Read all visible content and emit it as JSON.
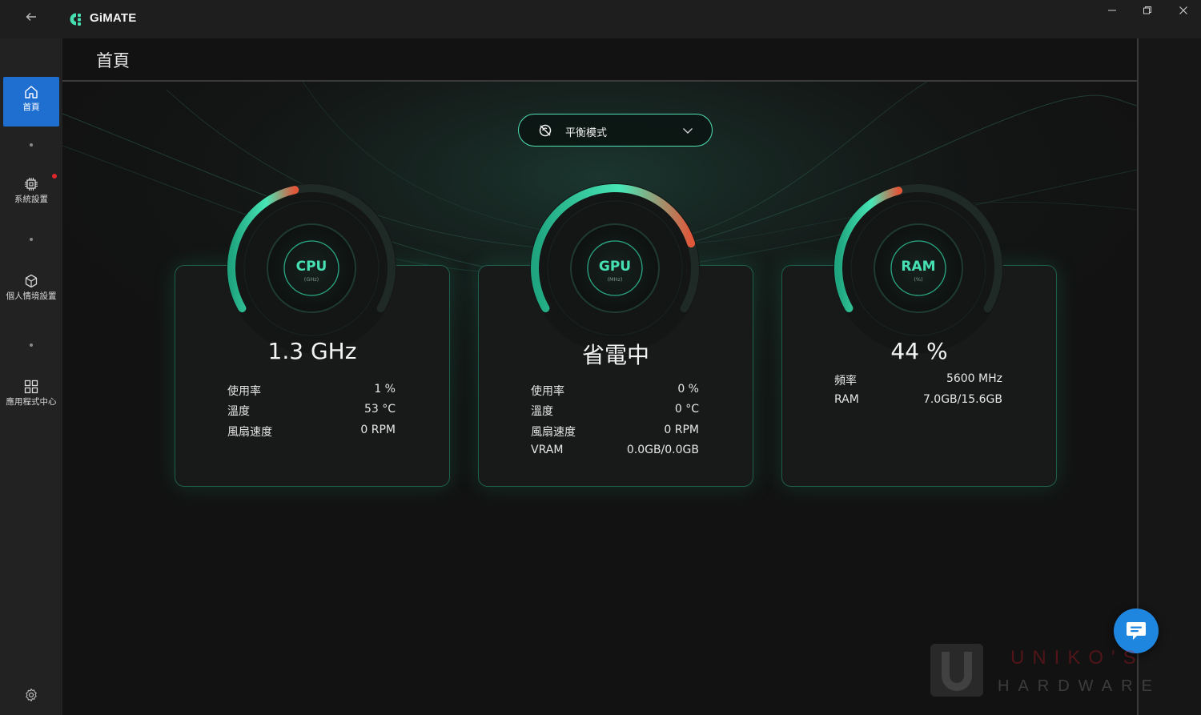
{
  "app": {
    "title": "GiMATE",
    "back_icon": "arrow-left-icon",
    "window_controls": [
      "minimize",
      "restore",
      "close"
    ]
  },
  "sidebar": {
    "items": [
      {
        "label": "首頁",
        "icon": "home-icon",
        "active": true
      },
      {
        "label": "系統設置",
        "icon": "chip-icon",
        "active": false,
        "notification": true
      },
      {
        "label": "個人情境設置",
        "icon": "cube-icon",
        "active": false
      },
      {
        "label": "應用程式中心",
        "icon": "apps-grid-icon",
        "active": false
      }
    ],
    "settings_icon": "gear-icon"
  },
  "page": {
    "title": "首頁"
  },
  "mode_select": {
    "value": "平衡模式",
    "icon": "balance-mode-icon"
  },
  "cards": {
    "cpu": {
      "name": "CPU",
      "unit": "(GHz)",
      "value": "1.3 GHz",
      "level": 0.45,
      "stats": [
        {
          "label": "使用率",
          "value": "1 %"
        },
        {
          "label": "溫度",
          "value": "53 °C"
        },
        {
          "label": "風扇速度",
          "value": "0 RPM"
        }
      ]
    },
    "gpu": {
      "name": "GPU",
      "unit": "(MHz)",
      "value": "省電中",
      "level": 0.8,
      "stats": [
        {
          "label": "使用率",
          "value": "0 %"
        },
        {
          "label": "溫度",
          "value": "0 °C"
        },
        {
          "label": "風扇速度",
          "value": "0 RPM"
        },
        {
          "label": "VRAM",
          "value": "0.0GB/0.0GB"
        }
      ]
    },
    "ram": {
      "name": "RAM",
      "unit": "(%)",
      "value": "44 %",
      "level": 0.44,
      "stats": [
        {
          "label": "頻率",
          "value": "5600 MHz"
        },
        {
          "label": "RAM",
          "value": "7.0GB/15.6GB"
        }
      ]
    }
  },
  "watermark": {
    "line1": "UNIKO'S",
    "line2": "HARDWARE"
  },
  "colors": {
    "accent": "#46e0b3",
    "active_nav": "#1f6fd1",
    "gauge_hot": "#e0573a",
    "chat": "#1f86e0"
  }
}
